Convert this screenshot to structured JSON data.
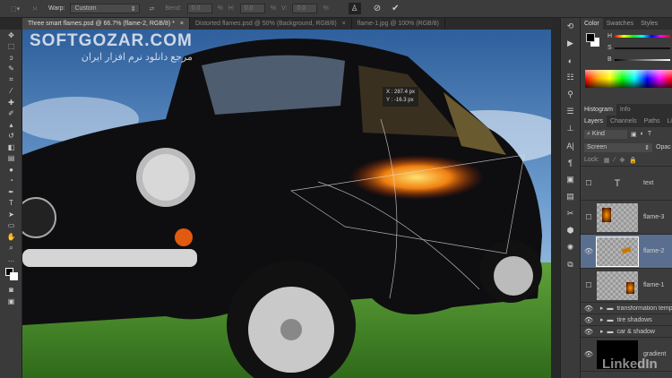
{
  "options_bar": {
    "warp_label": "Warp:",
    "warp_value": "Custom",
    "bend_label": "Bend:",
    "bend_value": "0.0",
    "h_label": "H:",
    "h_value": "0.0",
    "v_label": "V:",
    "v_value": "0.0",
    "percent": "%"
  },
  "tabs": [
    {
      "label": "Three smart flames.psd @ 66.7% (flame-2, RGB/8) *",
      "active": true
    },
    {
      "label": "Distorted flames.psd @ 50% (Background, RGB/8)",
      "active": false
    },
    {
      "label": "flame-1.jpg @ 100% (RGB/8)",
      "active": false
    }
  ],
  "watermark": {
    "title": "SOFTGOZAR.COM",
    "subtitle": "مرجع دانلود نرم افزار ایران"
  },
  "transform_readout": {
    "x": "X : 287.4 px",
    "y": "Y : -16.3 px"
  },
  "color_panel": {
    "tabs": [
      "Color",
      "Swatches",
      "Styles"
    ],
    "sliders": [
      "H",
      "S",
      "B"
    ]
  },
  "histogram_tabs": [
    "Histogram",
    "Info"
  ],
  "layers_panel": {
    "tabs": [
      "Layers",
      "Channels",
      "Paths",
      "Lib"
    ],
    "filter": "Kind",
    "blend_mode": "Screen",
    "opacity_label": "Opac",
    "lock_label": "Lock:",
    "layers": [
      {
        "name": "text",
        "type": "text",
        "visible": false
      },
      {
        "name": "flame-3",
        "type": "smart",
        "visible": false
      },
      {
        "name": "flame-2",
        "type": "smart",
        "visible": true,
        "selected": true
      },
      {
        "name": "flame-1",
        "type": "smart",
        "visible": false
      },
      {
        "name": "transformation temp",
        "type": "group",
        "visible": true
      },
      {
        "name": "tire shadows",
        "type": "group",
        "visible": true
      },
      {
        "name": "car & shadow",
        "type": "group",
        "visible": true
      },
      {
        "name": "gradient",
        "type": "fill",
        "visible": true
      }
    ]
  },
  "branding": "LinkedIn",
  "colors": {
    "accent_selected": "#5a6f8f",
    "panel_bg": "#3c3c3c"
  }
}
